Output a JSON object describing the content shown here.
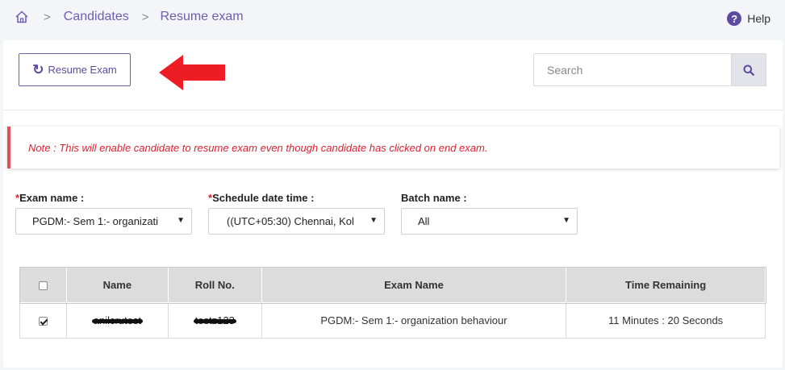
{
  "breadcrumb": {
    "home_icon": "home-icon",
    "items": [
      "Candidates",
      "Resume exam"
    ]
  },
  "help": {
    "label": "Help",
    "icon": "question-circle-icon"
  },
  "toolbar": {
    "resume_label": "Resume Exam",
    "resume_icon": "refresh-icon",
    "search_placeholder": "Search",
    "search_icon": "search-icon"
  },
  "note": "Note : This will enable candidate to resume exam even though candidate has clicked on end exam.",
  "filters": {
    "exam_name": {
      "label": "Exam name :",
      "required": "*",
      "value": "PGDM:- Sem 1:- organizati"
    },
    "schedule": {
      "label": "Schedule date time :",
      "required": "*",
      "value": "((UTC+05:30) Chennai, Kol"
    },
    "batch": {
      "label": "Batch name :",
      "value": "All"
    }
  },
  "table": {
    "headers": [
      "Name",
      "Roll No.",
      "Exam Name",
      "Time Remaining"
    ],
    "rows": [
      {
        "checked": true,
        "name": "anilcrutest",
        "roll": "testz123",
        "exam": "PGDM:- Sem 1:- organization behaviour",
        "time": "11 Minutes : 20 Seconds"
      }
    ]
  },
  "colors": {
    "accent": "#5c4ba0",
    "note_red": "#e0202f",
    "arrow_red": "#ee1c24"
  }
}
